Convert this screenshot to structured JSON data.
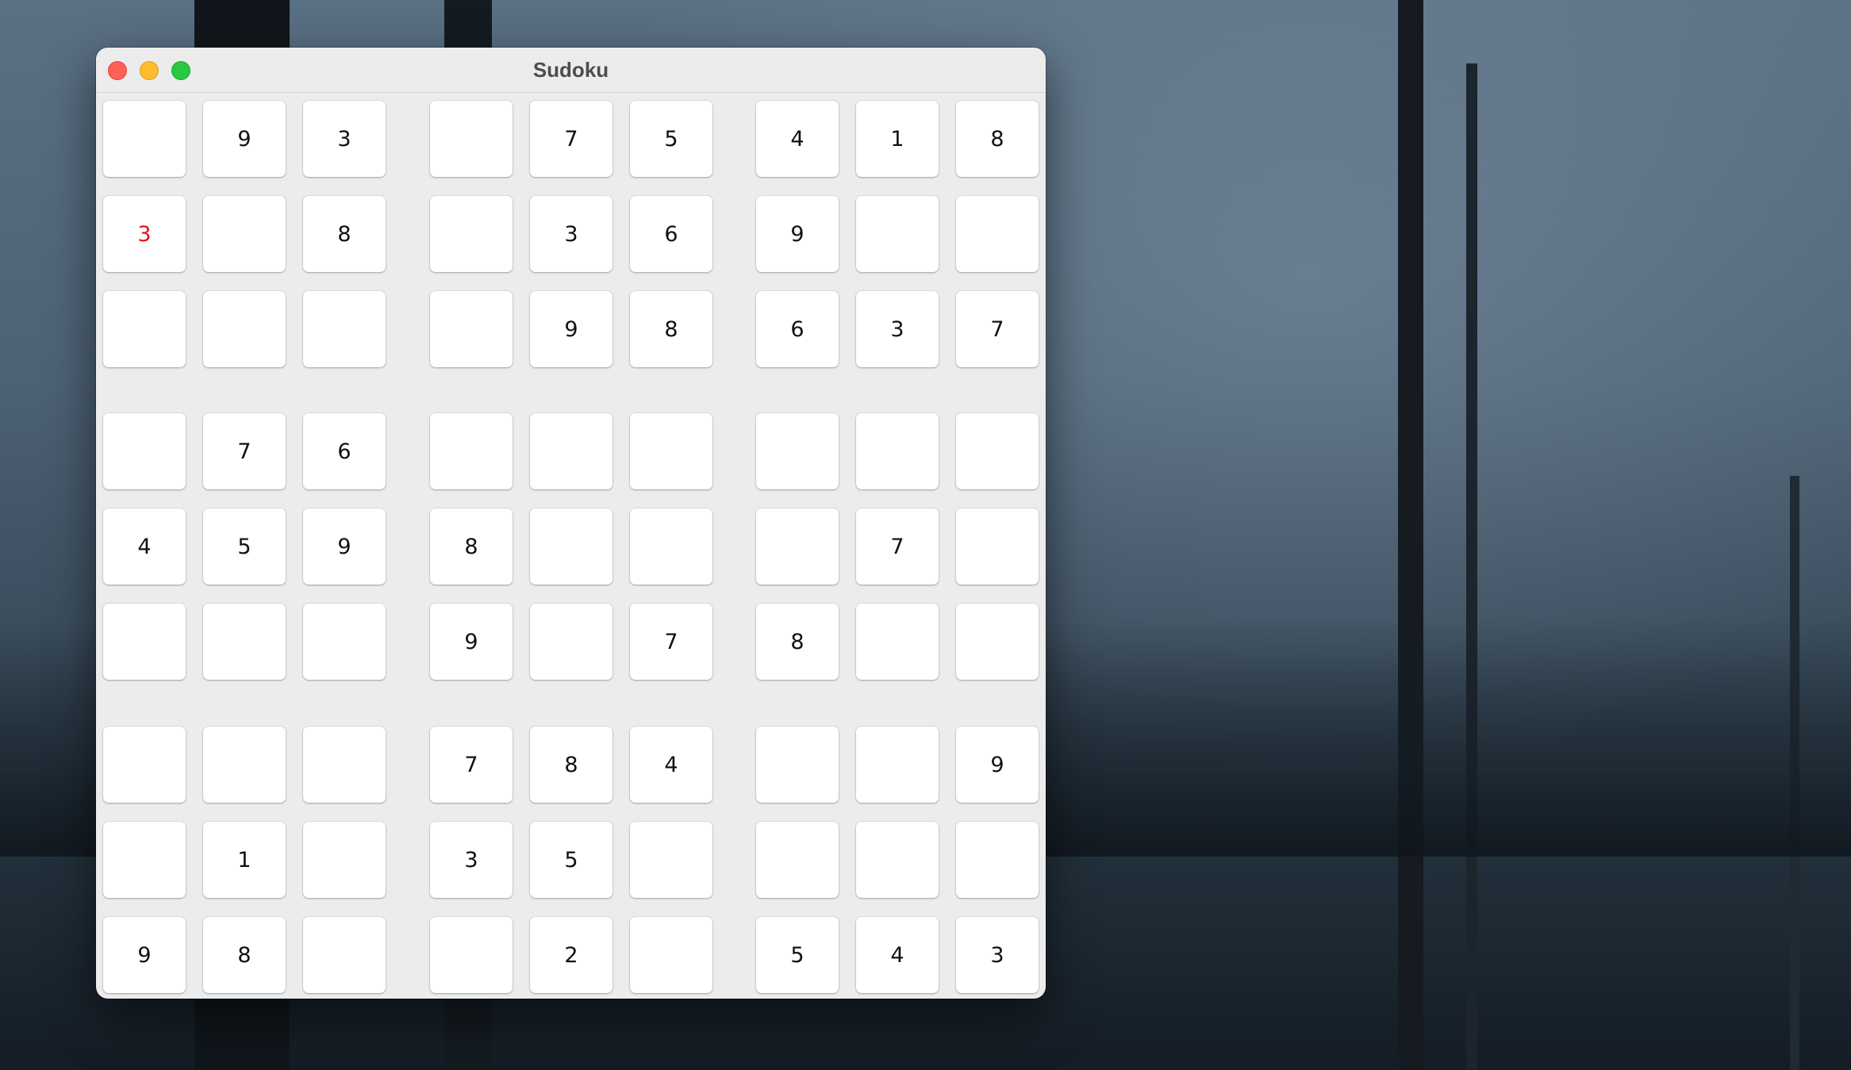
{
  "window": {
    "title": "Sudoku"
  },
  "colors": {
    "error_digit": "#e0161b",
    "digit": "#111111",
    "cell_background": "#ffffff",
    "window_background": "#ececec"
  },
  "board": {
    "rows": [
      [
        "",
        "9",
        "3",
        "",
        "7",
        "5",
        "4",
        "1",
        "8"
      ],
      [
        "3",
        "",
        "8",
        "",
        "3",
        "6",
        "9",
        "",
        ""
      ],
      [
        "",
        "",
        "",
        "",
        "9",
        "8",
        "6",
        "3",
        "7"
      ],
      [
        "",
        "7",
        "6",
        "",
        "",
        "",
        "",
        "",
        ""
      ],
      [
        "4",
        "5",
        "9",
        "8",
        "",
        "",
        "",
        "7",
        ""
      ],
      [
        "",
        "",
        "",
        "9",
        "",
        "7",
        "8",
        "",
        ""
      ],
      [
        "",
        "",
        "",
        "7",
        "8",
        "4",
        "",
        "",
        "9"
      ],
      [
        "",
        "1",
        "",
        "3",
        "5",
        "",
        "",
        "",
        ""
      ],
      [
        "9",
        "8",
        "",
        "",
        "2",
        "",
        "5",
        "4",
        "3"
      ]
    ],
    "error_cells": [
      [
        1,
        0
      ]
    ]
  }
}
